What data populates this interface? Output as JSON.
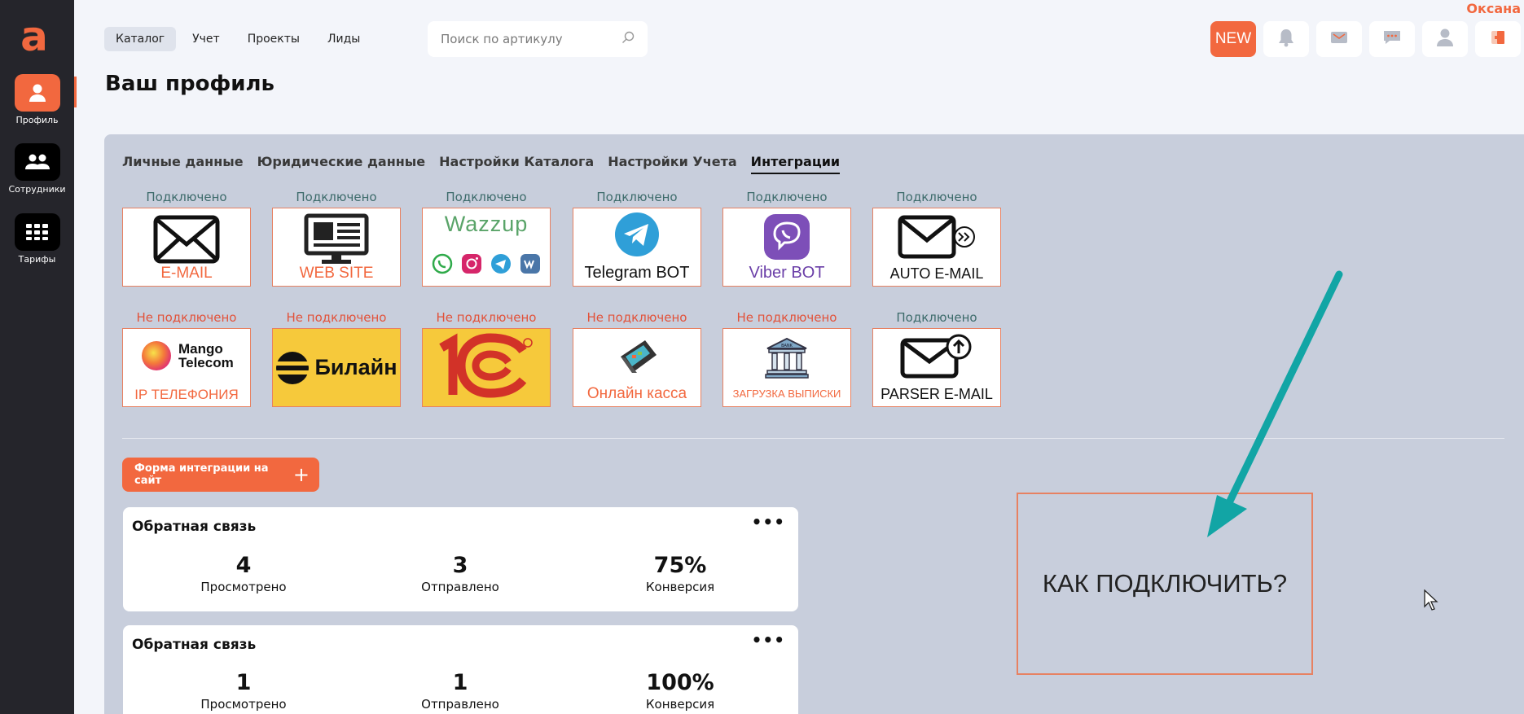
{
  "app": {
    "user_name": "Оксана",
    "logo_letter": "a"
  },
  "sidebar": {
    "items": [
      {
        "label": "Профиль",
        "icon": "profile-icon",
        "active": true
      },
      {
        "label": "Сотрудники",
        "icon": "employees-icon",
        "active": false
      },
      {
        "label": "Тарифы",
        "icon": "tariffs-icon",
        "active": false
      }
    ]
  },
  "topnav": {
    "items": [
      {
        "label": "Каталог",
        "active": true
      },
      {
        "label": "Учет"
      },
      {
        "label": "Проекты"
      },
      {
        "label": "Лиды"
      }
    ]
  },
  "search": {
    "placeholder": "Поиск по артикулу"
  },
  "header_buttons": {
    "new_label": "NEW"
  },
  "page": {
    "title": "Ваш профиль"
  },
  "tabs": [
    {
      "label": "Личные данные"
    },
    {
      "label": "Юридические данные"
    },
    {
      "label": "Настройки Каталога"
    },
    {
      "label": "Настройки Учета"
    },
    {
      "label": "Интеграции",
      "active": true
    }
  ],
  "integrations": {
    "row1": [
      {
        "status": "Подключено",
        "caption": "E-MAIL",
        "icon": "envelope-icon"
      },
      {
        "status": "Подключено",
        "caption": "WEB SITE",
        "icon": "monitor-icon"
      },
      {
        "status": "Подключено",
        "caption": "Wazzup",
        "icon": "wazzup-logo"
      },
      {
        "status": "Подключено",
        "caption": "Telegram BOT",
        "icon": "telegram-icon"
      },
      {
        "status": "Подключено",
        "caption": "Viber BOT",
        "icon": "viber-icon"
      },
      {
        "status": "Подключено",
        "caption": "AUTO E-MAIL",
        "icon": "auto-email-icon"
      }
    ],
    "row2": [
      {
        "status": "Не подключено",
        "caption": "IP ТЕЛЕФОНИЯ",
        "logo_text": "Mango Telecom",
        "icon": "mango-logo"
      },
      {
        "status": "Не подключено",
        "caption": "Билайн",
        "icon": "beeline-logo"
      },
      {
        "status": "Не подключено",
        "caption": "1C",
        "icon": "1c-logo"
      },
      {
        "status": "Не подключено",
        "caption": "Онлайн касса",
        "icon": "cash-register-icon"
      },
      {
        "status": "Не подключено",
        "caption": "ЗАГРУЗКА ВЫПИСКИ",
        "bank_text": "BANK",
        "icon": "bank-icon"
      },
      {
        "status": "Подключено",
        "caption": "PARSER E-MAIL",
        "icon": "parser-email-icon"
      }
    ]
  },
  "form_button": {
    "label": "Форма интеграции на сайт",
    "plus": "+"
  },
  "feedback_cards": [
    {
      "title": "Обратная связь",
      "viewed": "4",
      "viewed_label": "Просмотрено",
      "sent": "3",
      "sent_label": "Отправлено",
      "conversion": "75%",
      "conversion_label": "Конверсия"
    },
    {
      "title": "Обратная связь",
      "viewed": "1",
      "viewed_label": "Просмотрено",
      "sent": "1",
      "sent_label": "Отправлено",
      "conversion": "100%",
      "conversion_label": "Конверсия"
    }
  ],
  "howto": {
    "label": "КАК ПОДКЛЮЧИТЬ?"
  },
  "colors": {
    "accent": "#f2683f",
    "sidebar": "#25252b",
    "panel": "#c8cedc",
    "arrow": "#12a5a5",
    "connected": "#3d6b6b",
    "disconnected": "#e2523a"
  }
}
